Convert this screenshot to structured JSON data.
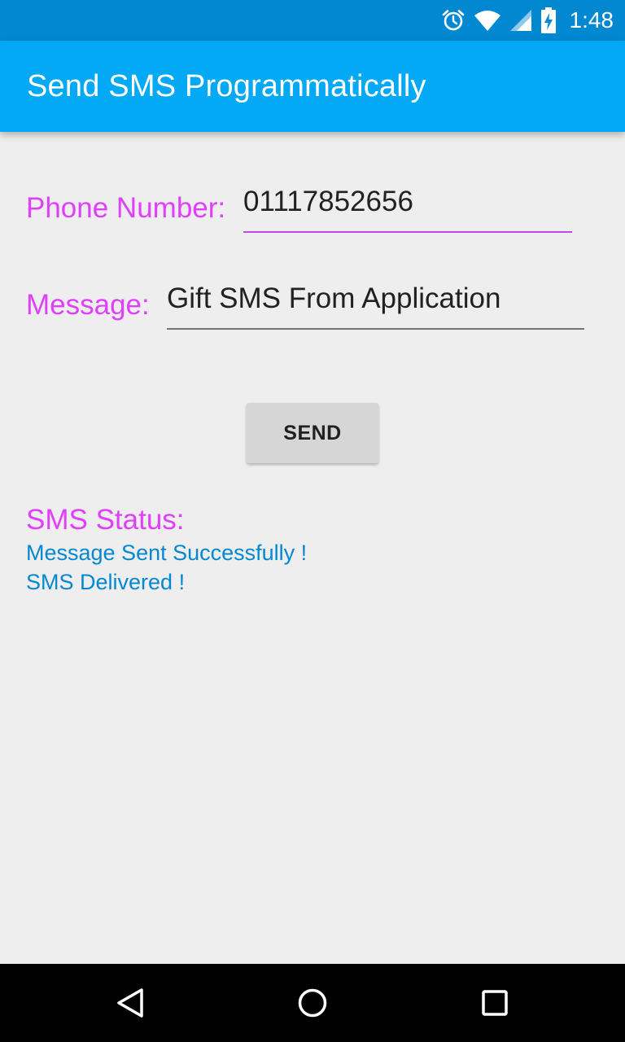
{
  "status_bar": {
    "time": "1:48",
    "icons": [
      "alarm-icon",
      "wifi-icon",
      "cell-signal-icon",
      "battery-charging-icon"
    ]
  },
  "app_bar": {
    "title": "Send SMS Programmatically"
  },
  "form": {
    "phone_label": "Phone Number:",
    "phone_value": "01117852656",
    "message_label": "Message:",
    "message_value": "Gift SMS From Application",
    "send_label": "SEND"
  },
  "status": {
    "label": "SMS Status:",
    "lines": [
      "Message Sent Successfully !",
      "SMS Delivered !"
    ]
  },
  "nav_bar": {
    "icons": [
      "back-icon",
      "home-icon",
      "recents-icon"
    ]
  },
  "colors": {
    "status_bar": "#0288d1",
    "app_bar": "#03a9f4",
    "label_accent": "#e040fb",
    "status_text": "#0288d1",
    "background": "#eeeeee"
  }
}
